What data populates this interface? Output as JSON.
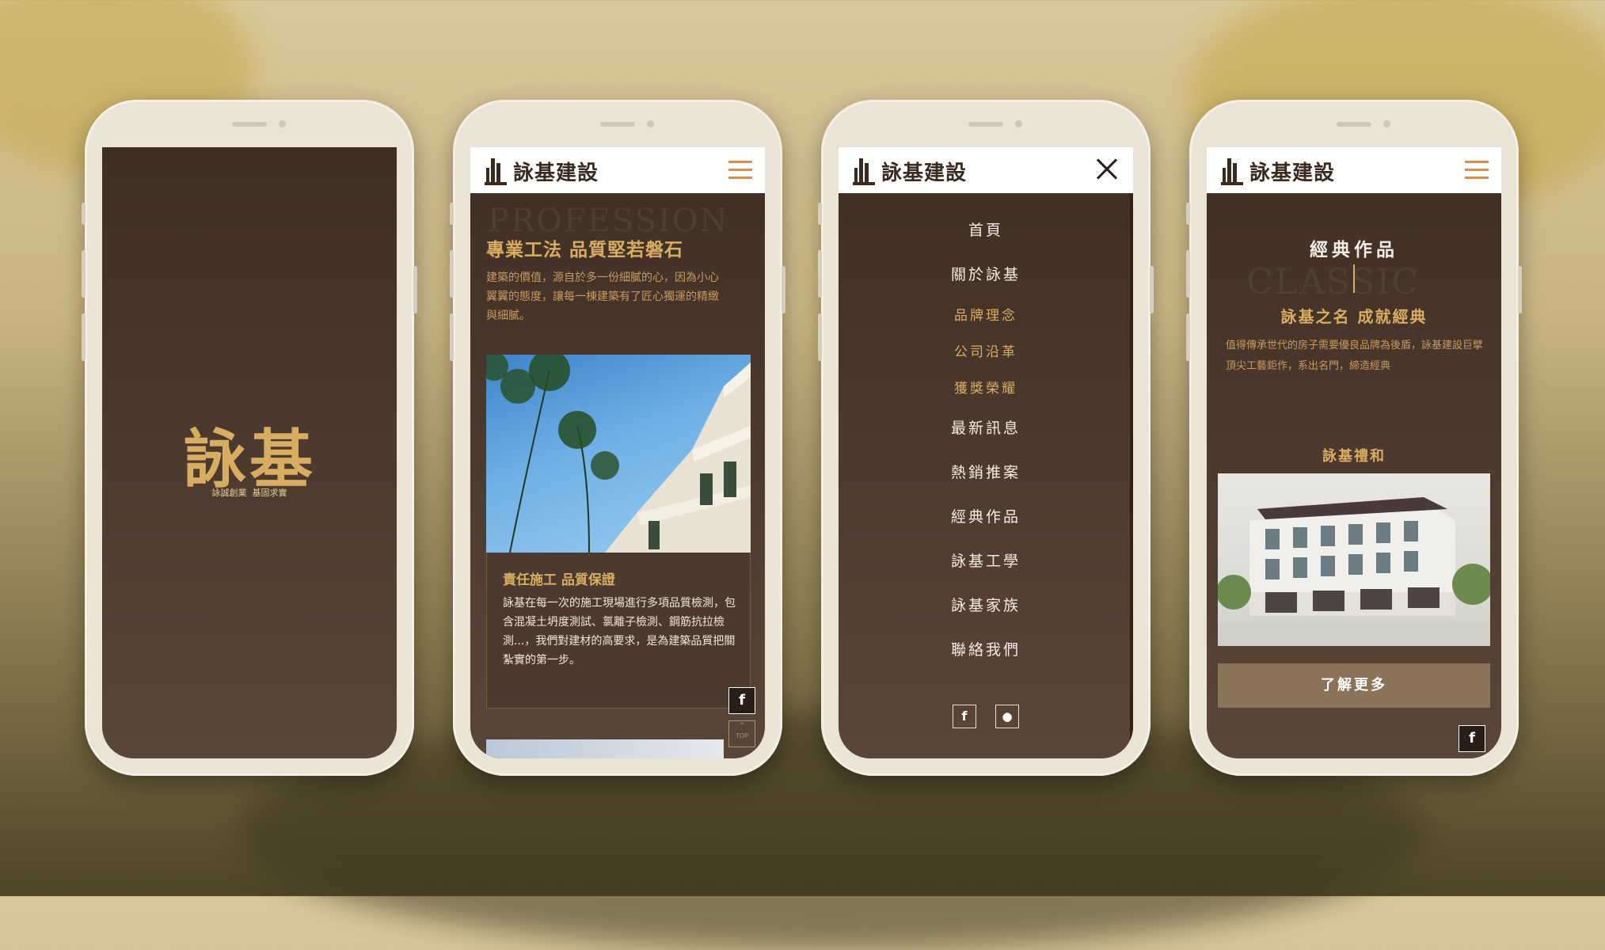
{
  "brand": {
    "logo_text": "詠基建設"
  },
  "colors": {
    "gold": "#d8ad62",
    "brown_dark": "#3f2e24",
    "orange": "#d9904a",
    "button": "#8b735a"
  },
  "splash": {
    "brand_mark": "詠基",
    "slogan": "詠誠創業  基固求實"
  },
  "profession": {
    "watermark": "PROFESSION",
    "title": "專業工法 品質堅若磐石",
    "intro": "建築的價值，源自於多一份細膩的心，因為小心翼翼的態度，讓每一棟建築有了匠心獨運的精緻與細膩。",
    "card_title": "責任施工 品質保證",
    "card_text": "詠基在每一次的施工現場進行多項品質檢測，包含混凝土坍度測試、氯離子檢測、鋼筋抗拉檢測...，我們對建材的高要求，是為建築品質把關紮實的第一步。",
    "top_label": "TOP"
  },
  "menu": {
    "items": [
      {
        "label": "首頁",
        "highlight": false
      },
      {
        "label": "關於詠基",
        "highlight": false
      },
      {
        "label": "品牌理念",
        "highlight": true
      },
      {
        "label": "公司沿革",
        "highlight": true
      },
      {
        "label": "獲獎榮耀",
        "highlight": true
      },
      {
        "label": "最新訊息",
        "highlight": false
      },
      {
        "label": "熱銷推案",
        "highlight": false
      },
      {
        "label": "經典作品",
        "highlight": false
      },
      {
        "label": "詠基工學",
        "highlight": false
      },
      {
        "label": "詠基家族",
        "highlight": false
      },
      {
        "label": "聯絡我們",
        "highlight": false
      }
    ]
  },
  "classic": {
    "watermark": "CLASSIC",
    "title": "經典作品",
    "subtitle": "詠基之名 成就經典",
    "intro": "值得傳承世代的房子需要優良品牌為後盾，詠基建設巨擘頂尖工藝鉅作，系出名門，締造經典",
    "project_name": "詠基禮和",
    "cta": "了解更多"
  }
}
